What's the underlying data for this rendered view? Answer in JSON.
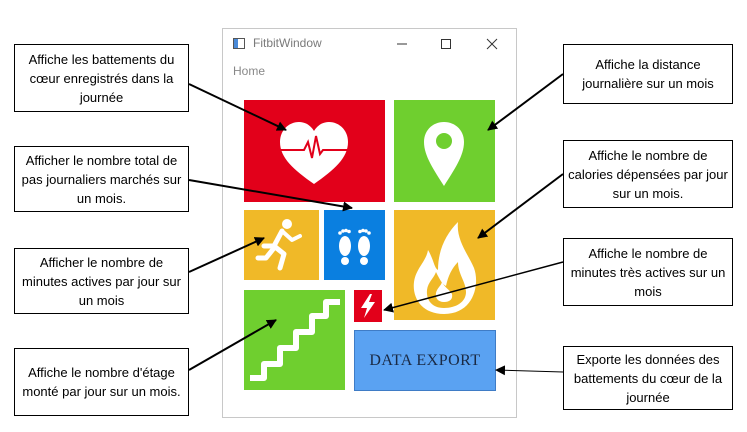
{
  "window": {
    "title": "FitbitWindow",
    "menu_home": "Home",
    "export_button": "DATA EXPORT"
  },
  "annotations": {
    "heart": "Affiche les battements du cœur enregistrés dans la journée",
    "distance": "Affiche la distance journalière sur un mois",
    "steps": "Afficher le nombre total de pas journaliers marchés sur un mois.",
    "calories": "Affiche le nombre de calories dépensées par jour sur un mois.",
    "active": "Afficher le nombre de minutes actives par jour sur un mois",
    "very_active": "Affiche le nombre de minutes très actives sur un mois",
    "floors": "Affiche le nombre d'étage monté par jour sur un mois.",
    "export": "Exporte les données des battements du cœur de la journée"
  },
  "colors": {
    "heart_tile": "#e2001a",
    "map_tile": "#6fcf2f",
    "runner_tile": "#f0b928",
    "steps_tile": "#0a7fe0",
    "fire_tile": "#f0b928",
    "stairs_tile": "#6fcf2f",
    "bolt_tile": "#e2001a",
    "export_button": "#5aa2f2"
  },
  "icons": {
    "heart_tile": "heart-pulse-icon",
    "map_tile": "map-pin-icon",
    "runner_tile": "runner-icon",
    "steps_tile": "footprints-icon",
    "fire_tile": "flame-icon",
    "stairs_tile": "stairs-icon",
    "bolt_tile": "lightning-icon"
  }
}
